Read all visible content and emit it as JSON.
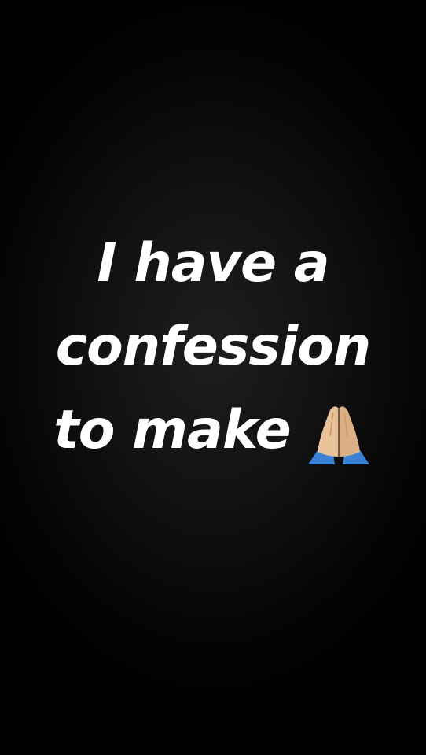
{
  "caption": {
    "line1": "I have a",
    "line2": "confession",
    "line3": "to make"
  },
  "icons": {
    "emoji": "folded-hands-icon"
  },
  "colors": {
    "background": "#000000",
    "text": "#ffffff",
    "skin": "#e9c29a",
    "sleeve": "#3b82d6"
  }
}
